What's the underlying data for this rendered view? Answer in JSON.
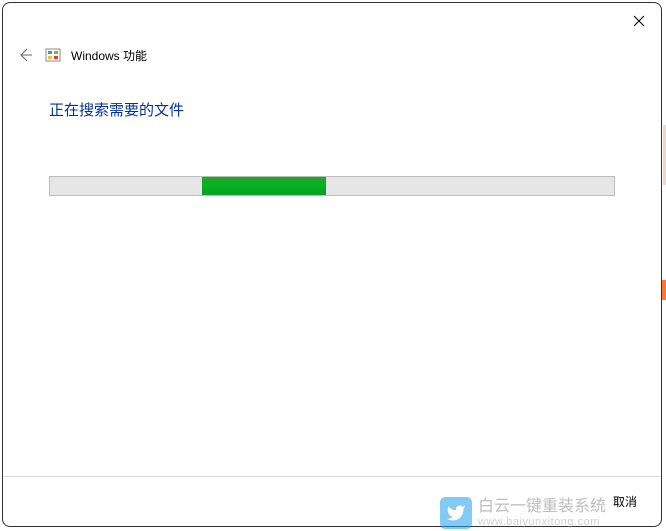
{
  "dialog": {
    "title": "Windows 功能",
    "status_message": "正在搜索需要的文件",
    "cancel_label": "取消"
  },
  "progress": {
    "indeterminate": true,
    "segment_left_percent": 27,
    "segment_width_percent": 22
  },
  "watermark": {
    "main_text": "白云一键重装系统",
    "sub_text": "www.baiyunxitong.com"
  }
}
